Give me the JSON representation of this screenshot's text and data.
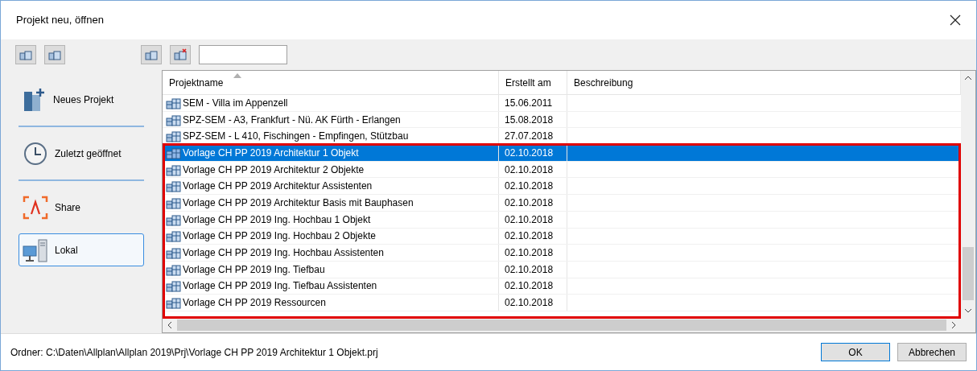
{
  "window": {
    "title": "Projekt neu, öffnen"
  },
  "sidebar": {
    "items": [
      {
        "kind": "new",
        "label": "Neues Projekt",
        "selected": false
      },
      {
        "kind": "recent",
        "label": "Zuletzt geöffnet",
        "selected": false
      },
      {
        "kind": "share",
        "label": "Share",
        "selected": false
      },
      {
        "kind": "local",
        "label": "Lokal",
        "selected": true
      }
    ]
  },
  "table": {
    "columns": [
      "Projektname",
      "Erstellt am",
      "Beschreibung"
    ],
    "rows": [
      {
        "name": "SEM - Villa im Appenzell",
        "created": "15.06.2011",
        "selected": false
      },
      {
        "name": "SPZ-SEM - A3, Frankfurt - Nü.  AK Fürth - Erlangen",
        "created": "15.08.2018",
        "selected": false
      },
      {
        "name": "SPZ-SEM - L 410, Fischingen - Empfingen, Stützbau",
        "created": "27.07.2018",
        "selected": false
      },
      {
        "name": "Vorlage CH PP 2019 Architektur 1 Objekt",
        "created": "02.10.2018",
        "selected": true
      },
      {
        "name": "Vorlage CH PP 2019 Architektur 2 Objekte",
        "created": "02.10.2018",
        "selected": false
      },
      {
        "name": "Vorlage CH PP 2019 Architektur Assistenten",
        "created": "02.10.2018",
        "selected": false
      },
      {
        "name": "Vorlage CH PP 2019 Architektur Basis mit Bauphasen",
        "created": "02.10.2018",
        "selected": false
      },
      {
        "name": "Vorlage CH PP 2019 Ing. Hochbau 1 Objekt",
        "created": "02.10.2018",
        "selected": false
      },
      {
        "name": "Vorlage CH PP 2019 Ing. Hochbau 2 Objekte",
        "created": "02.10.2018",
        "selected": false
      },
      {
        "name": "Vorlage CH PP 2019 Ing. Hochbau Assistenten",
        "created": "02.10.2018",
        "selected": false
      },
      {
        "name": "Vorlage CH PP 2019 Ing. Tiefbau",
        "created": "02.10.2018",
        "selected": false
      },
      {
        "name": "Vorlage CH PP 2019 Ing. Tiefbau Assistenten",
        "created": "02.10.2018",
        "selected": false
      },
      {
        "name": "Vorlage CH PP 2019 Ressourcen",
        "created": "02.10.2018",
        "selected": false
      }
    ]
  },
  "status_bar": {
    "path": "Ordner: C:\\Daten\\Allplan\\Allplan 2019\\Prj\\Vorlage CH PP 2019 Architektur 1 Objekt.prj"
  },
  "buttons": [
    "OK",
    "Abbrechen"
  ]
}
